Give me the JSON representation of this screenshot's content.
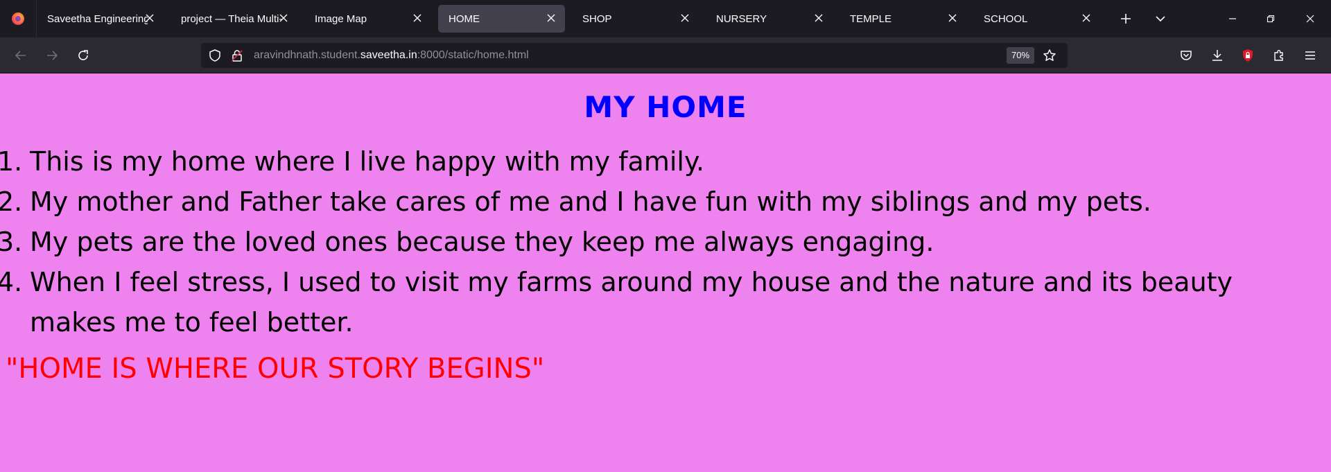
{
  "browser": {
    "tabs": [
      {
        "label": "Saveetha Engineering",
        "active": false
      },
      {
        "label": "project — Theia Multi-",
        "active": false
      },
      {
        "label": "Image Map",
        "active": false
      },
      {
        "label": "HOME",
        "active": true
      },
      {
        "label": "SHOP",
        "active": false
      },
      {
        "label": "NURSERY",
        "active": false
      },
      {
        "label": "TEMPLE",
        "active": false
      },
      {
        "label": "SCHOOL",
        "active": false
      }
    ],
    "url": {
      "prefix": "aravindhnath.student.",
      "domain": "saveetha.in",
      "suffix": ":8000/static/home.html"
    },
    "zoom": "70%",
    "icons": {
      "logo": "firefox-icon",
      "new_tab": "plus-icon",
      "list_tabs": "chevron-down-icon",
      "back": "arrow-left-icon",
      "forward": "arrow-right-icon",
      "reload": "reload-icon",
      "tracking": "shield-icon",
      "site_info": "lock-icon",
      "bookmark": "star-icon",
      "pocket": "pocket-icon",
      "downloads": "download-icon",
      "extension": "ublock-icon",
      "extensions": "puzzle-icon",
      "menu": "hamburger-icon"
    },
    "colors": {
      "tabstrip": "#1c1b22",
      "navbar": "#2b2a33",
      "active_tab": "#42414d"
    }
  },
  "page": {
    "title": "MY HOME",
    "items": [
      {
        "num": "1.",
        "text": "This is my home where I live happy with my family."
      },
      {
        "num": "2.",
        "text": "My mother and Father take cares of me and I have fun with my siblings and my pets."
      },
      {
        "num": "3.",
        "text": "My pets are the loved ones because they keep me always engaging."
      },
      {
        "num": "4.",
        "text": "When I feel stress, I used to visit my farms around my house and the nature and its beauty makes me to feel better."
      }
    ],
    "quote": "\"HOME IS WHERE OUR STORY BEGINS\"",
    "colors": {
      "background": "#ee82ee",
      "title": "#0000ff",
      "quote": "#ff0000"
    }
  }
}
